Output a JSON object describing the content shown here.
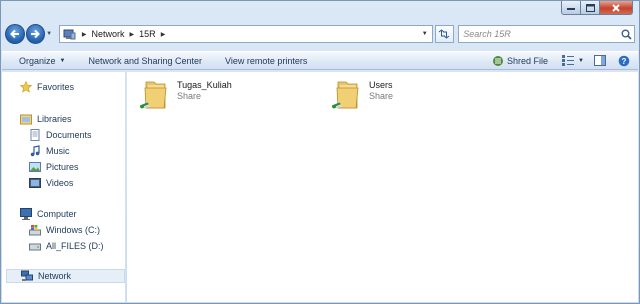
{
  "window": {
    "caption_buttons": [
      "minimize",
      "maximize",
      "close"
    ]
  },
  "address": {
    "crumbs": [
      "Network",
      "15R"
    ]
  },
  "search": {
    "placeholder": "Search 15R"
  },
  "commands": {
    "organize": "Organize",
    "sharing_center": "Network and Sharing Center",
    "view_printers": "View remote printers",
    "shred": "Shred File"
  },
  "sidebar": {
    "favorites": "Favorites",
    "libraries": "Libraries",
    "documents": "Documents",
    "music": "Music",
    "pictures": "Pictures",
    "videos": "Videos",
    "computer": "Computer",
    "drive_c": "Windows (C:)",
    "drive_d": "All_FILES (D:)",
    "network": "Network"
  },
  "items": [
    {
      "name": "Tugas_Kuliah",
      "type": "Share"
    },
    {
      "name": "Users",
      "type": "Share"
    }
  ],
  "colors": {
    "accent": "#1e395b",
    "selection": "#e6eef8",
    "close": "#c5432d"
  }
}
